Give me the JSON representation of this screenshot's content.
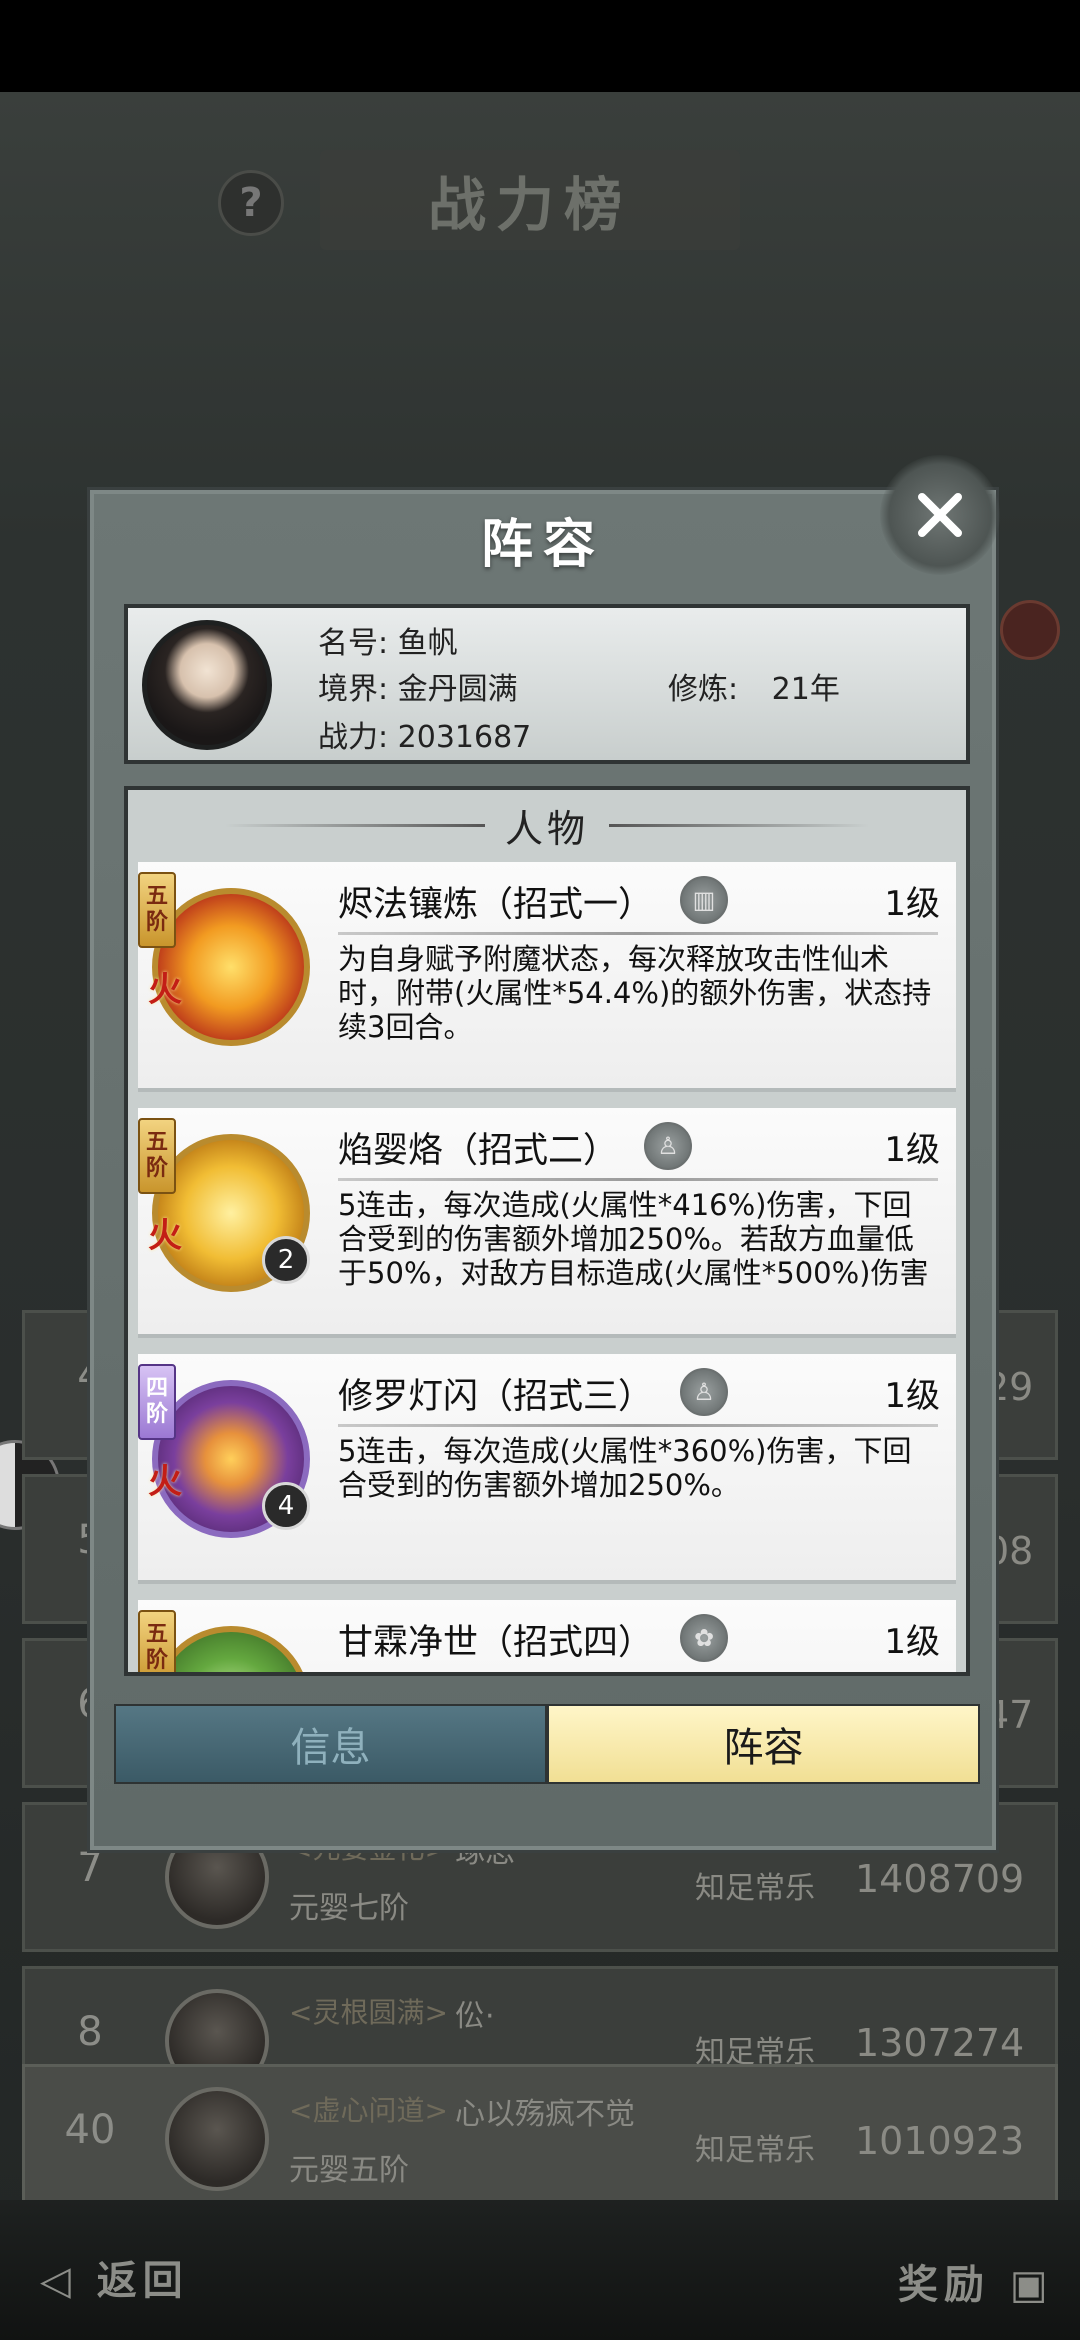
{
  "background": {
    "title": "战力榜",
    "help_icon_text": "?",
    "rows": [
      {
        "rank": "7",
        "tag": "<元婴金化>",
        "name": "琢思",
        "stage": "元婴七阶",
        "sect": "知足常乐",
        "power": "1408709"
      },
      {
        "rank": "8",
        "tag": "<灵根圆满>",
        "name": "伀·",
        "stage": "",
        "sect": "知足常乐",
        "power": "1307274"
      },
      {
        "rank": "40",
        "tag": "<虚心问道>",
        "name": "心以殇疯不觉",
        "stage": "元婴五阶",
        "sect": "知足常乐",
        "power": "1010923"
      }
    ],
    "partial_ranks": [
      "4",
      "5",
      "6"
    ],
    "partial_powers": [
      "29",
      "08",
      "47"
    ],
    "back_label": "返回",
    "reward_label": "奖励"
  },
  "modal": {
    "title": "阵容",
    "profile": {
      "name_label": "名号:",
      "name": "鱼帆",
      "realm_label": "境界:",
      "realm": "金丹圆满",
      "cultivation_label": "修炼:",
      "cultivation": "21年",
      "power_label": "战力:",
      "power": "2031687"
    },
    "section_title": "人物",
    "skills": [
      {
        "name": "烬法镶炼（招式一）",
        "level": "1级",
        "tier": [
          "五",
          "阶"
        ],
        "element": "火",
        "count": "",
        "description": "为自身赋予附魔状态，每次释放攻击性仙术时，附带(火属性*54.4%)的额外伤害，状态持续3回合。"
      },
      {
        "name": "焰婴烙（招式二）",
        "level": "1级",
        "tier": [
          "五",
          "阶"
        ],
        "element": "火",
        "count": "2",
        "description": "5连击，每次造成(火属性*416%)伤害，下回合受到的伤害额外增加250%。若敌方血量低于50%，对敌方目标造成(火属性*500%)伤害"
      },
      {
        "name": "修罗灯闪（招式三）",
        "level": "1级",
        "tier": [
          "四",
          "阶"
        ],
        "element": "火",
        "count": "4",
        "description": "5连击，每次造成(火属性*360%)伤害，下回合受到的伤害额外增加250%。"
      },
      {
        "name": "甘霖净世（招式四）",
        "level": "1级",
        "tier": [
          "五",
          "阶"
        ],
        "element": "",
        "count": "",
        "description": ""
      }
    ],
    "tabs": {
      "info": "信息",
      "lineup": "阵容"
    }
  },
  "colors": {
    "active_tab": "#f1df94",
    "inactive_tab": "#3b5a66",
    "modal_bg": "#6d7775"
  }
}
